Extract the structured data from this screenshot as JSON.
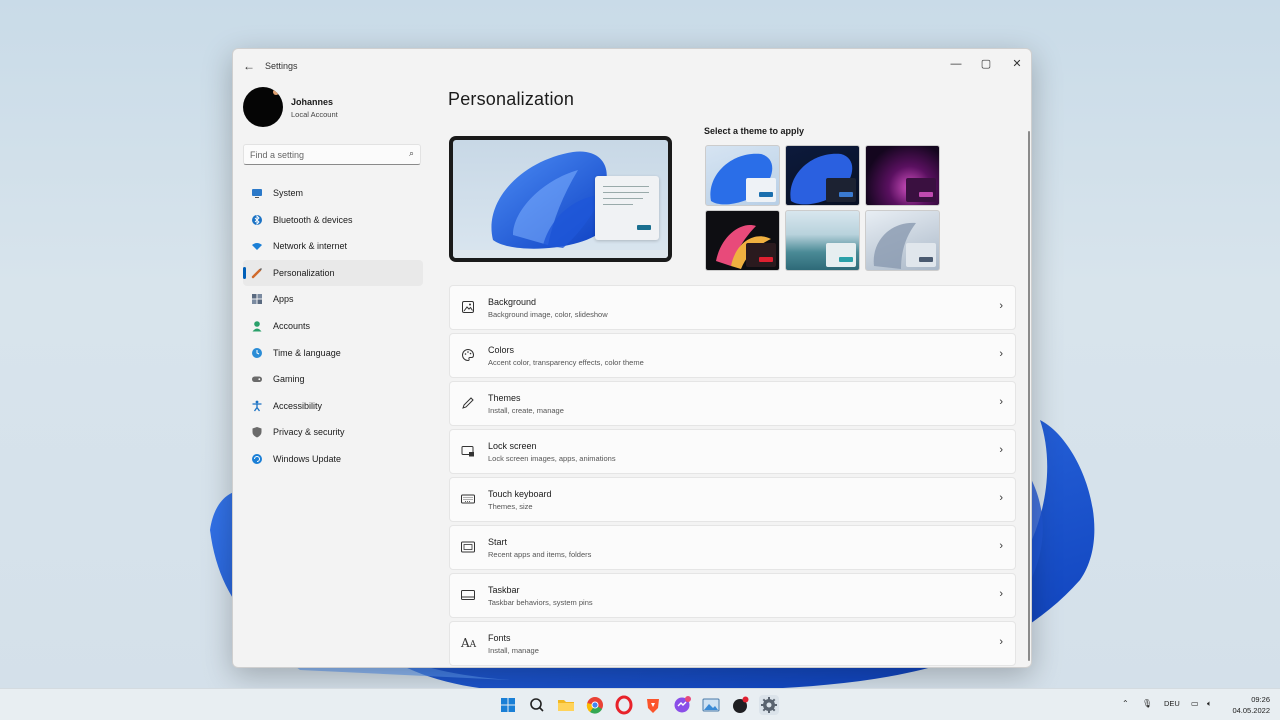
{
  "window": {
    "title": "Settings",
    "back_icon": "back-arrow-icon",
    "controls": {
      "minimize": "—",
      "maximize": "▢",
      "close": "✕"
    }
  },
  "profile": {
    "name": "Johannes",
    "account_type": "Local Account"
  },
  "search": {
    "placeholder": "Find a setting",
    "icon": "search-icon"
  },
  "nav": {
    "items": [
      {
        "label": "System",
        "icon": "monitor-icon",
        "color": "#2b79c9"
      },
      {
        "label": "Bluetooth & devices",
        "icon": "bluetooth-icon",
        "color": "#1b72c4"
      },
      {
        "label": "Network & internet",
        "icon": "wifi-icon",
        "color": "#1b7fd6"
      },
      {
        "label": "Personalization",
        "icon": "brush-icon",
        "color": "#d06a2b",
        "active": true
      },
      {
        "label": "Apps",
        "icon": "apps-icon",
        "color": "#5a6a80"
      },
      {
        "label": "Accounts",
        "icon": "person-icon",
        "color": "#2aa06a"
      },
      {
        "label": "Time & language",
        "icon": "globe-clock-icon",
        "color": "#2a8cd6"
      },
      {
        "label": "Gaming",
        "icon": "gamepad-icon",
        "color": "#6a6a6a"
      },
      {
        "label": "Accessibility",
        "icon": "accessibility-icon",
        "color": "#1b72c4"
      },
      {
        "label": "Privacy & security",
        "icon": "shield-icon",
        "color": "#6a6a6a"
      },
      {
        "label": "Windows Update",
        "icon": "update-icon",
        "color": "#1b7fd6"
      }
    ]
  },
  "main": {
    "title": "Personalization",
    "themes_label": "Select a theme to apply",
    "cards": [
      {
        "title": "Background",
        "subtitle": "Background image, color, slideshow",
        "icon": "image-icon"
      },
      {
        "title": "Colors",
        "subtitle": "Accent color, transparency effects, color theme",
        "icon": "palette-icon"
      },
      {
        "title": "Themes",
        "subtitle": "Install, create, manage",
        "icon": "pen-icon"
      },
      {
        "title": "Lock screen",
        "subtitle": "Lock screen images, apps, animations",
        "icon": "lock-screen-icon"
      },
      {
        "title": "Touch keyboard",
        "subtitle": "Themes, size",
        "icon": "keyboard-icon"
      },
      {
        "title": "Start",
        "subtitle": "Recent apps and items, folders",
        "icon": "start-icon"
      },
      {
        "title": "Taskbar",
        "subtitle": "Taskbar behaviors, system pins",
        "icon": "taskbar-icon"
      },
      {
        "title": "Fonts",
        "subtitle": "Install, manage",
        "icon": "fonts-icon"
      }
    ]
  },
  "taskbar": {
    "language": "DEU",
    "time": "09:26",
    "date": "04.05.2022"
  },
  "colors": {
    "accent": "#005fb8",
    "window_bg": "#f3f3f3",
    "card_bg": "#fbfbfb"
  }
}
